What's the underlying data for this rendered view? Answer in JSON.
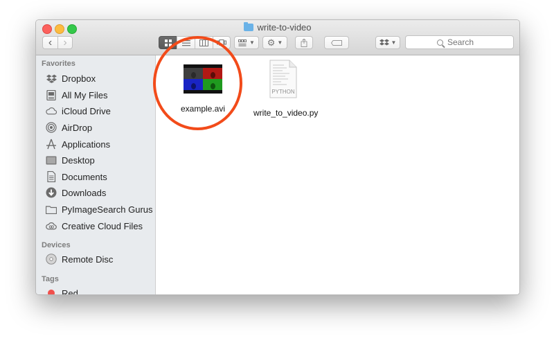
{
  "window": {
    "title": "write-to-video"
  },
  "toolbar": {
    "back_label": "‹",
    "forward_label": "›",
    "search_placeholder": "Search"
  },
  "sidebar": {
    "favorites_header": "Favorites",
    "favorites": [
      {
        "label": "Dropbox",
        "icon": "dropbox-icon"
      },
      {
        "label": "All My Files",
        "icon": "all-files-icon"
      },
      {
        "label": "iCloud Drive",
        "icon": "cloud-icon"
      },
      {
        "label": "AirDrop",
        "icon": "airdrop-icon"
      },
      {
        "label": "Applications",
        "icon": "applications-icon"
      },
      {
        "label": "Desktop",
        "icon": "desktop-icon"
      },
      {
        "label": "Documents",
        "icon": "documents-icon"
      },
      {
        "label": "Downloads",
        "icon": "downloads-icon"
      },
      {
        "label": "PyImageSearch Gurus",
        "icon": "folder-icon"
      },
      {
        "label": "Creative Cloud Files",
        "icon": "creative-cloud-icon"
      }
    ],
    "devices_header": "Devices",
    "devices": [
      {
        "label": "Remote Disc",
        "icon": "disc-icon"
      }
    ],
    "tags_header": "Tags",
    "tags": [
      {
        "label": "Red",
        "color": "#f0504c"
      }
    ]
  },
  "files": [
    {
      "name": "example.avi",
      "type": "video-thumbnail"
    },
    {
      "name": "write_to_video.py",
      "type": "python-document",
      "badge": "PYTHON"
    }
  ],
  "colors": {
    "highlight_circle": "#f24b1a",
    "sidebar_bg": "#e8ebee",
    "folder_blue": "#6ab2e7"
  }
}
